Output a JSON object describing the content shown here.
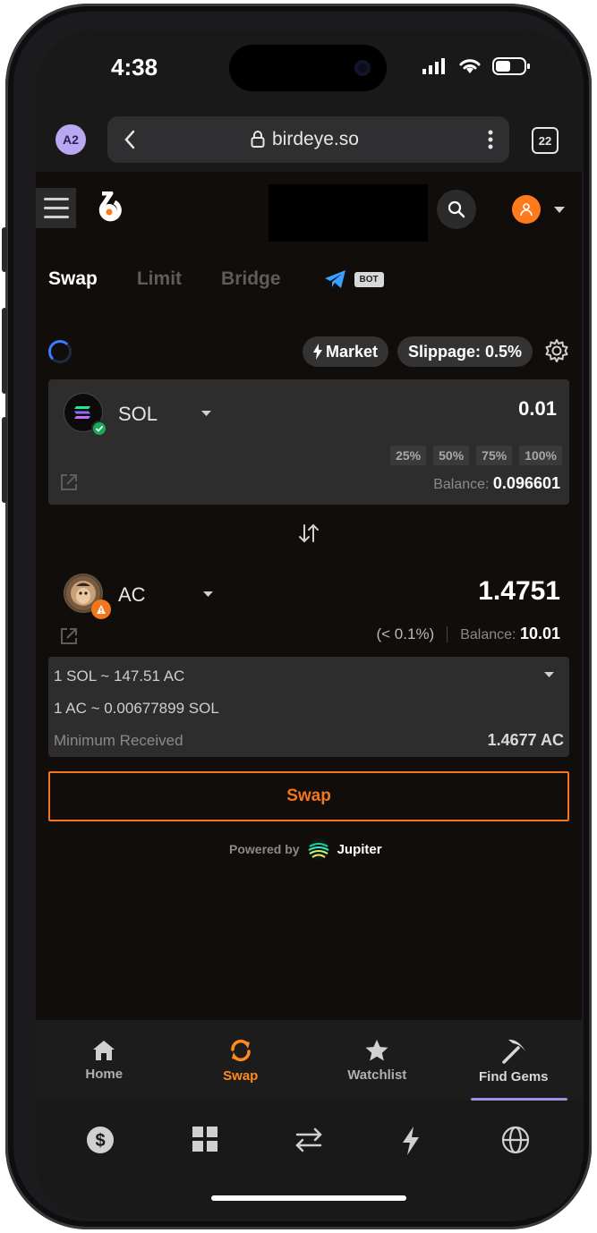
{
  "status": {
    "time": "4:38"
  },
  "browser": {
    "profile": "A2",
    "url": "birdeye.so",
    "tab_count": "22"
  },
  "mode_tabs": [
    {
      "label": "Swap",
      "active": true
    },
    {
      "label": "Limit",
      "active": false
    },
    {
      "label": "Bridge",
      "active": false
    }
  ],
  "bot_badge": "BOT",
  "options": {
    "market": "Market",
    "slippage": "Slippage: 0.5%"
  },
  "from": {
    "symbol": "SOL",
    "amount": "0.01",
    "percents": [
      "25%",
      "50%",
      "75%",
      "100%"
    ],
    "balance_label": "Balance:",
    "balance": "0.096601"
  },
  "to": {
    "symbol": "AC",
    "amount": "1.4751",
    "price_impact": "(< 0.1%)",
    "balance_label": "Balance:",
    "balance": "10.01"
  },
  "rates": {
    "rate1": "1 SOL ~ 147.51 AC",
    "rate2": "1 AC ~ 0.00677899 SOL",
    "min_label": "Minimum Received",
    "min_value": "1.4677 AC"
  },
  "swap_button": "Swap",
  "powered": {
    "prefix": "Powered by",
    "name": "Jupiter"
  },
  "bottom_nav": [
    {
      "label": "Home",
      "icon": "home-icon"
    },
    {
      "label": "Swap",
      "icon": "swap-icon",
      "active": true
    },
    {
      "label": "Watchlist",
      "icon": "star-icon"
    },
    {
      "label": "Find Gems",
      "icon": "pickaxe-icon"
    }
  ],
  "colors": {
    "accent": "#f2761c",
    "background": "#110d0b",
    "panel": "#2d2d2d"
  }
}
